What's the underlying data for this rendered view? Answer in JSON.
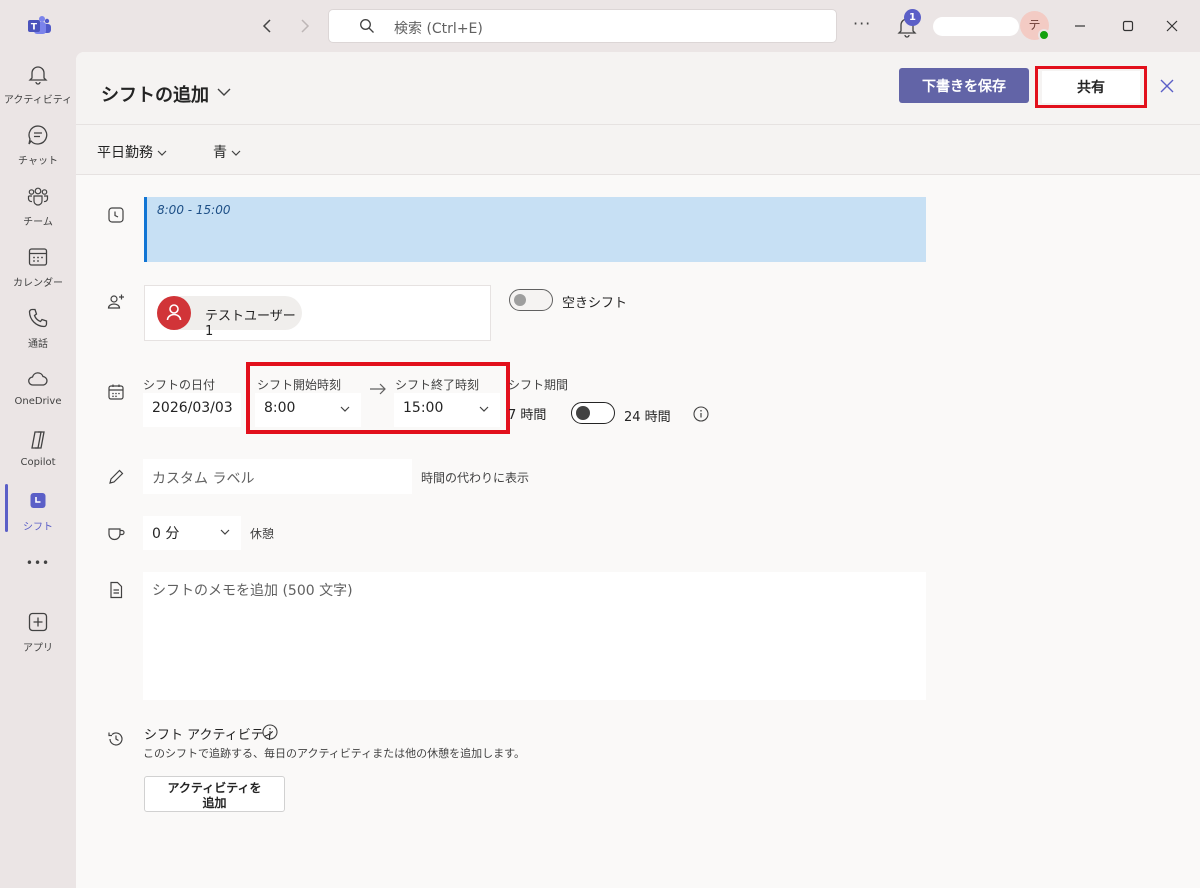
{
  "topbar": {
    "search_placeholder": "検索 (Ctrl+E)",
    "more": "···",
    "notification_count": "1",
    "avatar_initial": "テ"
  },
  "rail": {
    "items": [
      {
        "label": "アクティビティ",
        "icon": "bell-icon"
      },
      {
        "label": "チャット",
        "icon": "chat-icon"
      },
      {
        "label": "チーム",
        "icon": "teams-icon"
      },
      {
        "label": "カレンダー",
        "icon": "calendar-icon"
      },
      {
        "label": "通話",
        "icon": "phone-icon"
      },
      {
        "label": "OneDrive",
        "icon": "cloud-icon"
      },
      {
        "label": "Copilot",
        "icon": "copilot-icon"
      },
      {
        "label": "シフト",
        "icon": "shifts-icon"
      },
      {
        "label": "アプリ",
        "icon": "add-app-icon"
      }
    ],
    "more": "•••",
    "active": "シフト"
  },
  "header": {
    "title": "シフトの追加",
    "save_draft": "下書きを保存",
    "share": "共有"
  },
  "subbar": {
    "template": "平日勤務",
    "color": "青"
  },
  "form": {
    "time_preview": "8:00 - 15:00",
    "user_name": "テストユーザー1",
    "open_shift_label": "空きシフト",
    "date_label": "シフトの日付",
    "date_value": "2026/03/03",
    "start_label": "シフト開始時刻",
    "start_value": "8:00",
    "end_label": "シフト終了時刻",
    "end_value": "15:00",
    "duration_label": "シフト期間",
    "duration_value": "7 時間",
    "allday_label": "24 時間",
    "custom_label_placeholder": "カスタム ラベル",
    "custom_label_hint": "時間の代わりに表示",
    "break_value": "0 分",
    "break_label": "休憩",
    "notes_placeholder": "シフトのメモを追加 (500 文字)",
    "activity_title": "シフト アクティビティ",
    "activity_desc": "このシフトで追跡する、毎日のアクティビティまたは他の休憩を追加します。",
    "activity_button_line1": "アクティビティを",
    "activity_button_line2": "追加"
  },
  "colors": {
    "accent": "#5b5fc7",
    "highlight": "#e2101c",
    "time_bar": "#c7e0f4",
    "user_avatar": "#d13438"
  }
}
